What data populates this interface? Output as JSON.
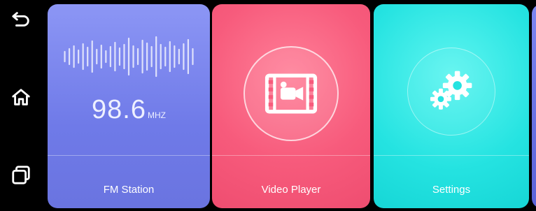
{
  "sidebar": {
    "items": [
      {
        "name": "back",
        "icon": "back-icon"
      },
      {
        "name": "home",
        "icon": "home-icon"
      },
      {
        "name": "recent-apps",
        "icon": "recent-apps-icon"
      }
    ]
  },
  "apps": {
    "fm": {
      "label": "FM Station",
      "frequency": "98.6",
      "unit": "MHZ",
      "color": "#7a84ee"
    },
    "video": {
      "label": "Video Player",
      "color": "#f75b7c"
    },
    "settings": {
      "label": "Settings",
      "color": "#25e3e1"
    }
  }
}
